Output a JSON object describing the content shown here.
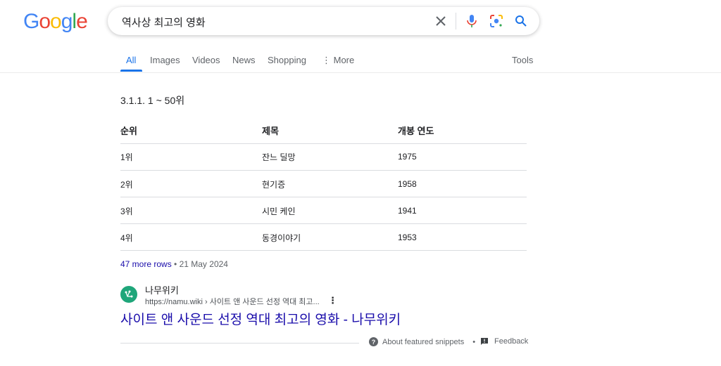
{
  "logo": "Google",
  "search": {
    "query": "역사상 최고의 영화"
  },
  "tabs": [
    {
      "label": "All",
      "active": true
    },
    {
      "label": "Images"
    },
    {
      "label": "Videos"
    },
    {
      "label": "News"
    },
    {
      "label": "Shopping"
    },
    {
      "label": "More"
    }
  ],
  "tools_label": "Tools",
  "snippet": {
    "section": "3.1.1. 1 ~ 50위",
    "headers": [
      "순위",
      "제목",
      "개봉 연도"
    ],
    "rows": [
      [
        "1위",
        "잔느 딜망",
        "1975"
      ],
      [
        "2위",
        "현기증",
        "1958"
      ],
      [
        "3위",
        "시민 케인",
        "1941"
      ],
      [
        "4위",
        "동경이야기",
        "1953"
      ]
    ],
    "more_rows": "47 more rows",
    "date": "21 May 2024"
  },
  "result": {
    "site": "나무위키",
    "url": "https://namu.wiki › 사이트 앤 사운드 선정 역대 최고...",
    "title": "사이트 앤 사운드 선정 역대 최고의 영화 - 나무위키"
  },
  "footer": {
    "about": "About featured snippets",
    "feedback": "Feedback"
  },
  "colors": {
    "link": "#1a0dab",
    "accent": "#1a73e8",
    "favicon": "#1fa67a"
  }
}
